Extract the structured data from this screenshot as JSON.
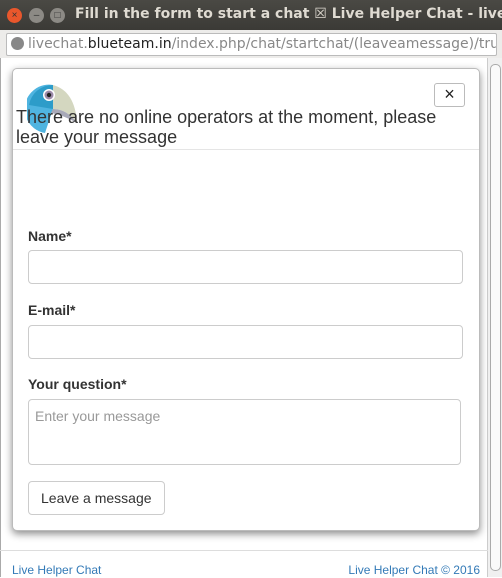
{
  "window": {
    "title": "Fill in the form to start a chat ☒ Live Helper Chat - live sup"
  },
  "address": {
    "prefix": "livechat.",
    "domain": "blueteam.in",
    "path": "/index.php/chat/startchat/(leaveamessage)/true,"
  },
  "modal": {
    "heading": "There are no online operators at the moment, please leave your message",
    "close_label": "×",
    "name_label": "Name*",
    "email_label": "E-mail*",
    "question_label": "Your question*",
    "question_placeholder": "Enter your message",
    "submit_label": "Leave a message"
  },
  "footer": {
    "left": "Live Helper Chat",
    "right": "Live Helper Chat © 2016"
  }
}
